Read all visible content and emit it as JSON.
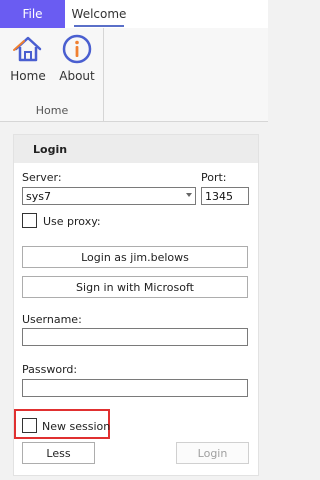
{
  "tabs": {
    "file": "File",
    "welcome": "Welcome"
  },
  "ribbon": {
    "home_label": "Home",
    "about_label": "About",
    "group_label": "Home"
  },
  "login": {
    "title": "Login",
    "server_label": "Server:",
    "server_value": "sys7",
    "port_label": "Port:",
    "port_value": "1345",
    "use_proxy_label": "Use proxy:",
    "login_as_label": "Login as  jim.belows",
    "microsoft_label": "Sign in with Microsoft",
    "username_label": "Username:",
    "username_value": "",
    "password_label": "Password:",
    "password_value": "",
    "new_session_label": "New session",
    "less_label": "Less",
    "login_button_label": "Login"
  },
  "colors": {
    "accent": "#6a5cf2",
    "icon": "#4a5fd0",
    "highlight": "#e03030"
  }
}
